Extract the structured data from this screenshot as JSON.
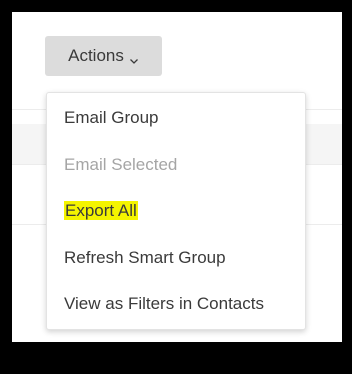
{
  "actions_button": {
    "label": "Actions",
    "icon": "chevron-down-icon"
  },
  "menu": {
    "items": [
      {
        "label": "Email Group",
        "enabled": true,
        "highlighted": false
      },
      {
        "label": "Email Selected",
        "enabled": false,
        "highlighted": false
      },
      {
        "label": "Export All",
        "enabled": true,
        "highlighted": true
      },
      {
        "label": "Refresh Smart Group",
        "enabled": true,
        "highlighted": false
      },
      {
        "label": "View as Filters in Contacts",
        "enabled": true,
        "highlighted": false
      }
    ]
  },
  "colors": {
    "frame": "#000000",
    "button_bg": "#dcdcdc",
    "text": "#3a3a3a",
    "disabled_text": "#a5a5a5",
    "highlight": "#f4f400"
  }
}
